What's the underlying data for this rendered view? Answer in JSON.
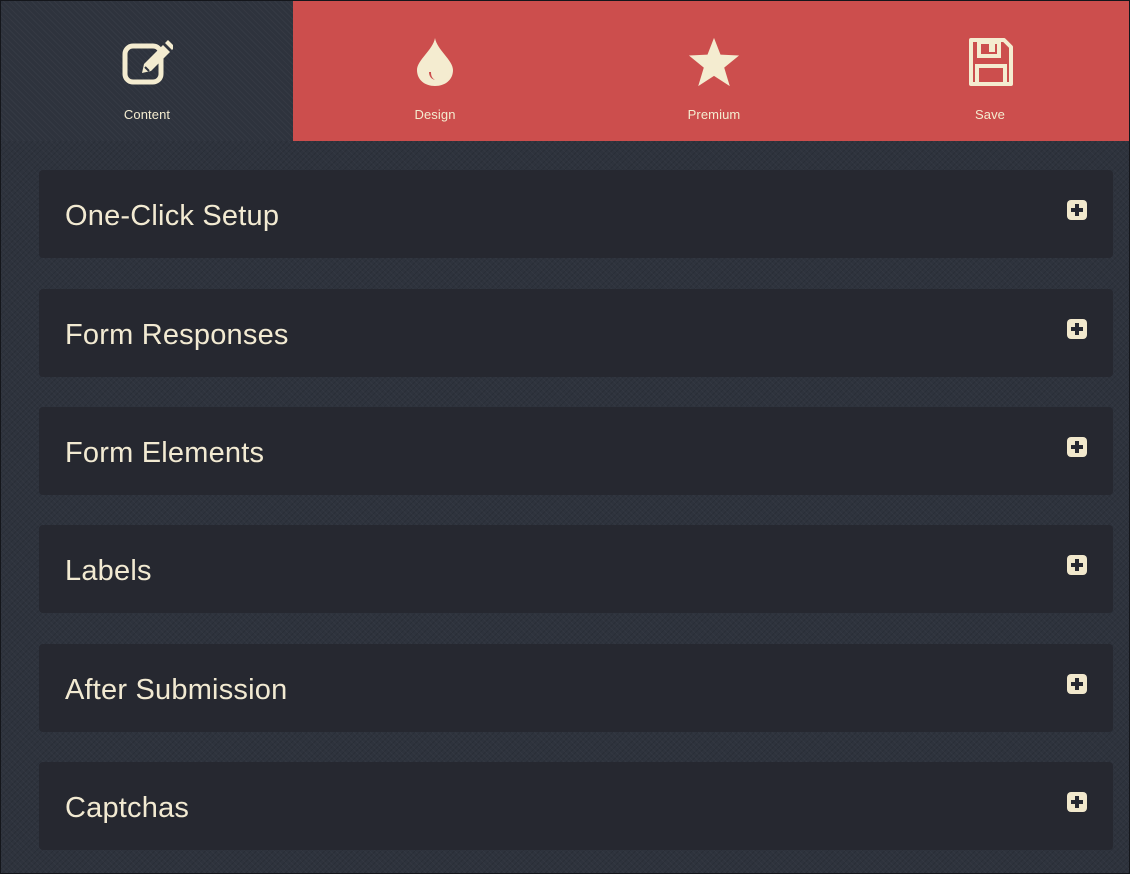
{
  "colors": {
    "accent": "#cc4e4d",
    "background": "#2e333d",
    "panel": "#262830",
    "text": "#f2ead2"
  },
  "tabs": [
    {
      "label": "Content",
      "icon": "edit-icon",
      "active": true
    },
    {
      "label": "Design",
      "icon": "drop-icon",
      "active": false
    },
    {
      "label": "Premium",
      "icon": "star-icon",
      "active": false
    },
    {
      "label": "Save",
      "icon": "floppy-disk-icon",
      "active": false
    }
  ],
  "panels": [
    {
      "title": "One-Click Setup",
      "icon": "plus-square-icon"
    },
    {
      "title": "Form Responses",
      "icon": "plus-square-icon"
    },
    {
      "title": "Form Elements",
      "icon": "plus-square-icon"
    },
    {
      "title": "Labels",
      "icon": "plus-square-icon"
    },
    {
      "title": "After Submission",
      "icon": "plus-square-icon"
    },
    {
      "title": "Captchas",
      "icon": "plus-square-icon"
    }
  ]
}
